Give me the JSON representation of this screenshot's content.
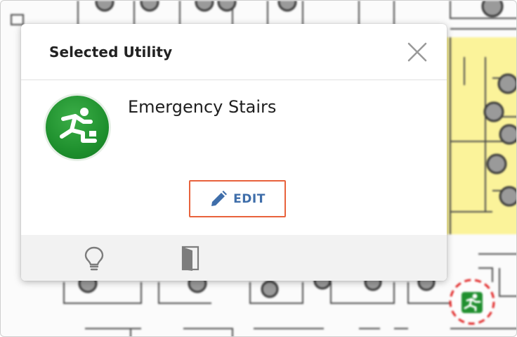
{
  "dialog": {
    "title": "Selected Utility",
    "close_icon": "close-icon"
  },
  "utility": {
    "name": "Emergency Stairs",
    "icon": "emergency-exit-icon",
    "icon_color": "#1f8f2e"
  },
  "actions": {
    "edit_label": "EDIT",
    "edit_icon": "pencil-icon",
    "highlight_color": "#e8623c",
    "accent_color": "#3f6eaa"
  },
  "footer": {
    "tabs": [
      {
        "icon": "lightbulb-icon"
      },
      {
        "icon": "door-icon"
      }
    ]
  },
  "floorplan": {
    "highlight_zone_color": "#fbf39a",
    "marker_icon": "emergency-exit-marker-icon",
    "marker_ring_color": "#e02424"
  }
}
